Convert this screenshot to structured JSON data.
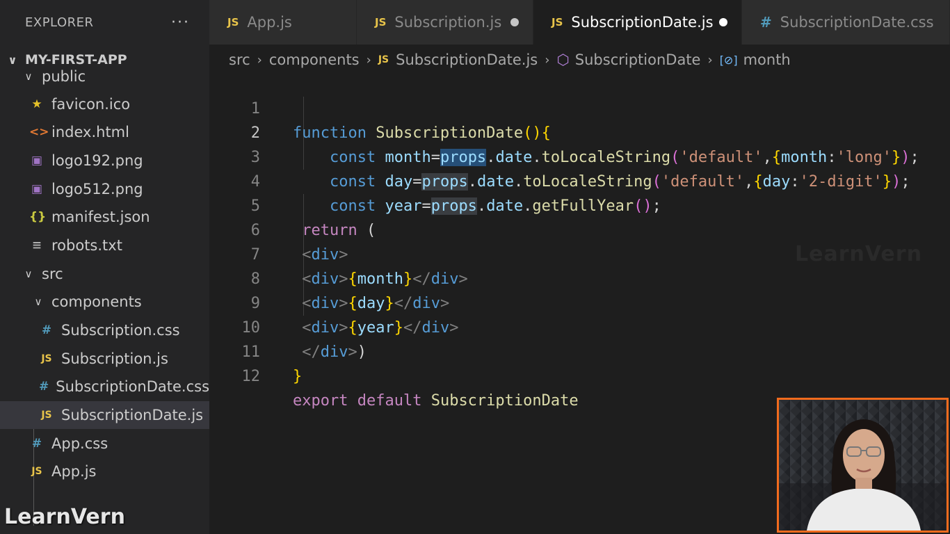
{
  "explorer": {
    "title": "EXPLORER",
    "more_label": "···",
    "project": "MY-FIRST-APP",
    "items": [
      {
        "label": "public",
        "kind": "folder",
        "icon": "chevron-down-icon"
      },
      {
        "label": "favicon.ico",
        "kind": "file",
        "icon": "star-icon"
      },
      {
        "label": "index.html",
        "kind": "file",
        "icon": "html-icon"
      },
      {
        "label": "logo192.png",
        "kind": "file",
        "icon": "image-icon"
      },
      {
        "label": "logo512.png",
        "kind": "file",
        "icon": "image-icon"
      },
      {
        "label": "manifest.json",
        "kind": "file",
        "icon": "json-icon"
      },
      {
        "label": "robots.txt",
        "kind": "file",
        "icon": "text-file-icon"
      },
      {
        "label": "src",
        "kind": "folder",
        "icon": "chevron-down-icon"
      },
      {
        "label": "components",
        "kind": "folder",
        "icon": "chevron-down-icon"
      },
      {
        "label": "Subscription.css",
        "kind": "file",
        "icon": "css-icon"
      },
      {
        "label": "Subscription.js",
        "kind": "file",
        "icon": "js-icon"
      },
      {
        "label": "SubscriptionDate.css",
        "kind": "file",
        "icon": "css-icon"
      },
      {
        "label": "SubscriptionDate.js",
        "kind": "file",
        "icon": "js-icon",
        "active": true
      },
      {
        "label": "App.css",
        "kind": "file",
        "icon": "css-icon"
      },
      {
        "label": "App.js",
        "kind": "file",
        "icon": "js-icon"
      }
    ]
  },
  "tabs": [
    {
      "label": "App.js",
      "icon_text": "JS",
      "modified": false,
      "active": false
    },
    {
      "label": "Subscription.js",
      "icon_text": "JS",
      "modified": true,
      "active": false
    },
    {
      "label": "SubscriptionDate.js",
      "icon_text": "JS",
      "modified": true,
      "active": true
    },
    {
      "label": "SubscriptionDate.css",
      "icon_text": "#",
      "modified": false,
      "active": false
    }
  ],
  "breadcrumb": {
    "parts": [
      "src",
      "components",
      "SubscriptionDate.js",
      "SubscriptionDate",
      "month"
    ],
    "js_icon": "JS"
  },
  "editor": {
    "current_line": 2,
    "line_numbers": [
      "1",
      "2",
      "3",
      "4",
      "5",
      "6",
      "7",
      "8",
      "9",
      "10",
      "11",
      "12"
    ],
    "lines": [
      "function SubscriptionDate(){",
      "    const month=props.date.toLocaleString('default',{month:'long'});",
      "    const day=props.date.toLocaleString('default',{day:'2-digit'});",
      "    const year=props.date.getFullYear();",
      " return (",
      " <div>",
      " <div>{month}</div>",
      " <div>{day}</div>",
      " <div>{year}</div>",
      " </div>)",
      "}",
      "export default SubscriptionDate"
    ]
  },
  "watermark": "LearnVern",
  "logo": "LearnVern",
  "colors": {
    "accent_border": "#f26b1d",
    "selection": "#264f78",
    "active_row": "#37373d"
  }
}
